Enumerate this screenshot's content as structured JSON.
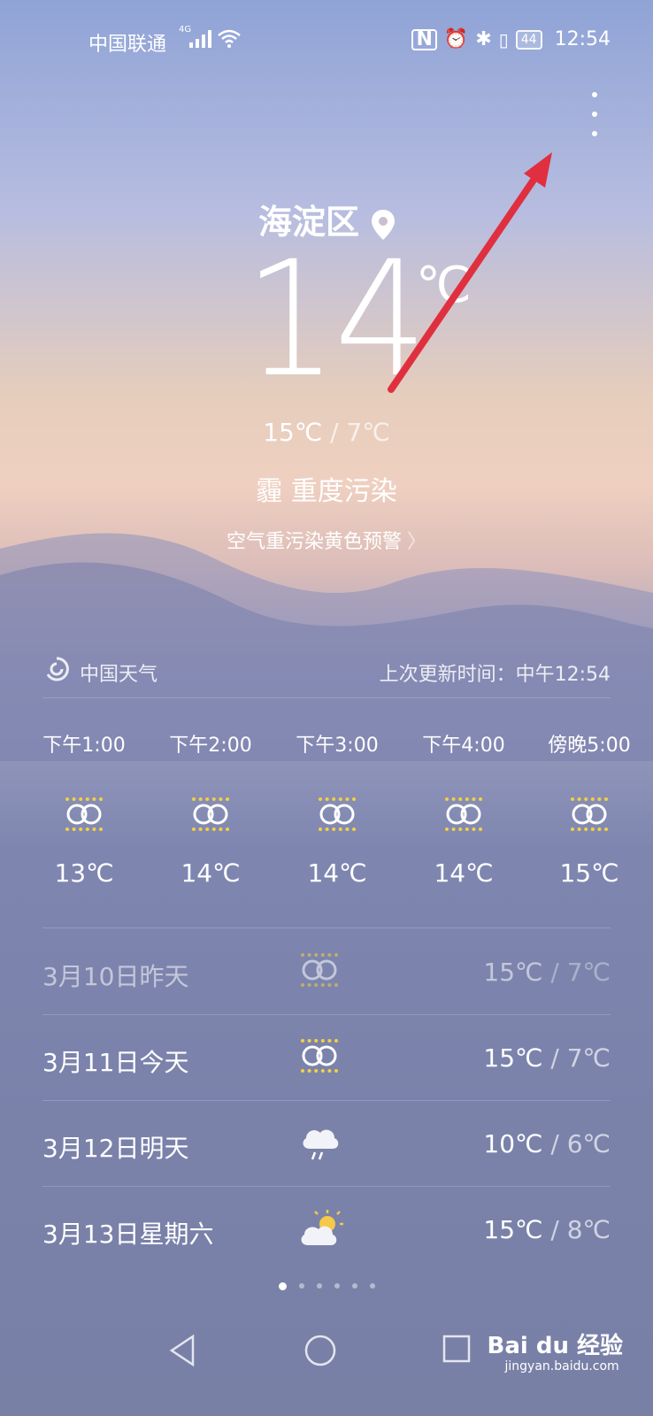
{
  "status": {
    "carrier": "中国联通",
    "network": "4G",
    "battery": "44",
    "time": "12:54"
  },
  "location": "海淀区",
  "current": {
    "temp": "14",
    "unit": "℃",
    "high": "15℃",
    "low": "7℃",
    "condition": "霾  重度污染",
    "alert": "空气重污染黄色预警"
  },
  "source": {
    "name": "中国天气",
    "updated": "上次更新时间：中午12:54"
  },
  "hourly": [
    {
      "time": "下午1:00",
      "temp": "13℃",
      "icon": "haze-icon"
    },
    {
      "time": "下午2:00",
      "temp": "14℃",
      "icon": "haze-icon"
    },
    {
      "time": "下午3:00",
      "temp": "14℃",
      "icon": "haze-icon"
    },
    {
      "time": "下午4:00",
      "temp": "14℃",
      "icon": "haze-icon"
    },
    {
      "time": "傍晚5:00",
      "temp": "15℃",
      "icon": "haze-icon"
    }
  ],
  "daily": [
    {
      "label": "3月10日昨天",
      "high": "15℃",
      "low": "7℃",
      "icon": "haze-icon"
    },
    {
      "label": "3月11日今天",
      "high": "15℃",
      "low": "7℃",
      "icon": "haze-icon"
    },
    {
      "label": "3月12日明天",
      "high": "10℃",
      "low": "6℃",
      "icon": "rain-icon"
    },
    {
      "label": "3月13日星期六",
      "high": "15℃",
      "low": "8℃",
      "icon": "partly-cloudy-icon"
    }
  ],
  "page_indicator": {
    "count": 6,
    "active": 1
  },
  "watermark": {
    "brand": "Bai du 经验",
    "url": "jingyan.baidu.com"
  },
  "colors": {
    "accent_arrow": "#e03040",
    "haze_yellow": "#f4d03f"
  }
}
